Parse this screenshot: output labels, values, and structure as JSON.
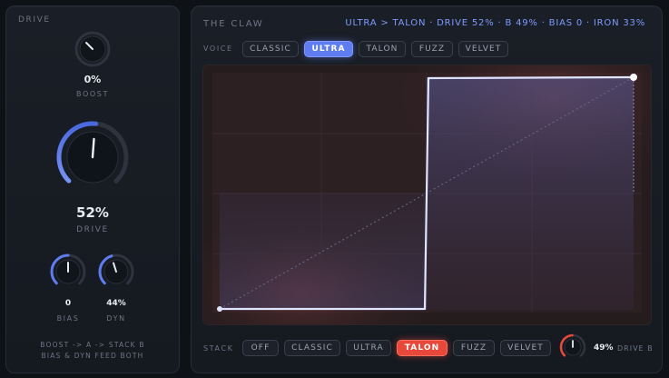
{
  "left_panel": {
    "title": "DRIVE",
    "boost": {
      "value": "0%",
      "label": "BOOST",
      "level": 0.0
    },
    "drive": {
      "value": "52%",
      "label": "DRIVE",
      "level": 0.52
    },
    "bias": {
      "value": "0",
      "label": "BIAS",
      "level": 0.5
    },
    "dyn": {
      "value": "44%",
      "label": "DYN",
      "level": 0.44
    },
    "footer_line1": "BOOST -> A -> STACK B",
    "footer_line2": "BIAS & DYN FEED BOTH"
  },
  "right_panel": {
    "title": "THE CLAW",
    "status": "ULTRA > TALON · DRIVE 52% · B 49% · BIAS 0 · IRON 33%",
    "voice_label": "VOICE",
    "voice_options": [
      "CLASSIC",
      "ULTRA",
      "TALON",
      "FUZZ",
      "VELVET"
    ],
    "voice_selected": "ULTRA",
    "stack_label": "STACK",
    "stack_options": [
      "OFF",
      "CLASSIC",
      "ULTRA",
      "TALON",
      "FUZZ",
      "VELVET"
    ],
    "stack_selected": "TALON",
    "drive_b": {
      "value": "49%",
      "label": "DRIVE B",
      "level": 0.49
    }
  },
  "colors": {
    "accent_blue": "#5f7cf0",
    "accent_red": "#e8483a",
    "status_text": "#7f9bff"
  }
}
